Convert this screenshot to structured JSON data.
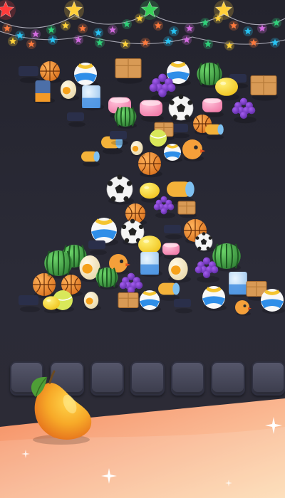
{
  "screen": {
    "background_color": "#2a2a36",
    "floor_color_a": "#f6a374",
    "floor_color_b": "#fde1b8"
  },
  "lights": {
    "bulb_colors": [
      "#ff7a3d",
      "#27c4f5",
      "#d36be0",
      "#2fd27a",
      "#ffd23a"
    ],
    "big_star_colors": [
      "#ff3b3b",
      "#ffcf3a",
      "#38d15a",
      "#ffcf3a"
    ]
  },
  "pile": {
    "item_types": [
      "basketball-icon",
      "soccer-ball-icon",
      "volleyball-icon",
      "watermelon-icon",
      "grape-bunch-icon",
      "cardboard-box-icon",
      "marshmallow-icon",
      "milk-carton-icon",
      "egg-icon",
      "lemon-icon",
      "cheese-roll-icon",
      "ice-cream-icon"
    ]
  },
  "tray": {
    "slot_count": 7,
    "slot_color": "#4a4b5e"
  },
  "selected_item": {
    "icon": "mango-icon",
    "colors": [
      "#f7a928",
      "#e86b1c",
      "#52a83a"
    ]
  }
}
